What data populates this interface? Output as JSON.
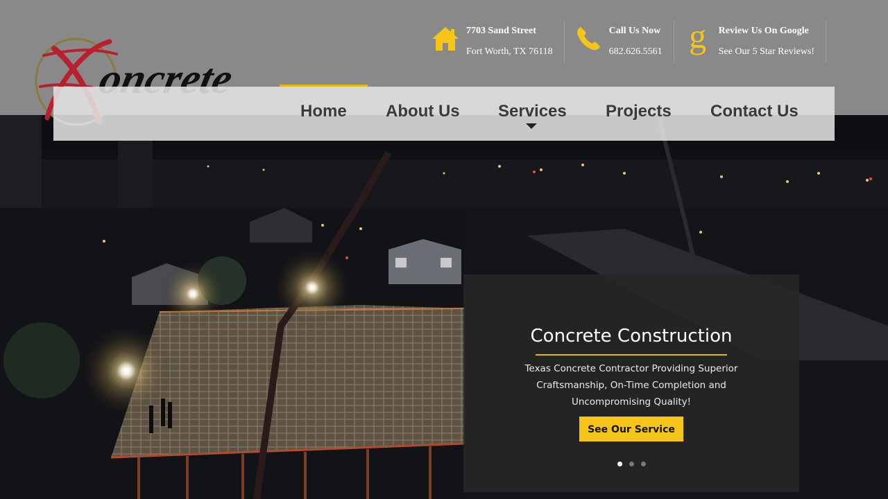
{
  "colors": {
    "accent": "#e8b610",
    "button": "#f5c518",
    "header_bg": "#898989",
    "nav_bg": "#e2e2e2"
  },
  "logo": {
    "text": "FXconcrete"
  },
  "contacts": [
    {
      "icon": "home-icon",
      "title": "7703 Sand Street",
      "sub": "Fort Worth, TX 76118"
    },
    {
      "icon": "phone-icon",
      "title": "Call Us Now",
      "sub": "682.626.5561"
    },
    {
      "icon": "google-icon",
      "title": "Review Us On Google",
      "sub": "See Our 5 Star Reviews!"
    }
  ],
  "nav": {
    "items": [
      {
        "label": "Home",
        "active": true
      },
      {
        "label": "About Us",
        "active": false
      },
      {
        "label": "Services",
        "active": false,
        "has_dropdown": true
      },
      {
        "label": "Projects",
        "active": false
      },
      {
        "label": "Contact Us",
        "active": false
      }
    ]
  },
  "slider": {
    "title": "Concrete Construction",
    "text": "Texas Concrete Contractor Providing Superior Craftsmanship, On-Time Completion and Uncompromising Quality!",
    "button_label": "See Our Service",
    "slide_count": 3,
    "active_slide": 1
  }
}
